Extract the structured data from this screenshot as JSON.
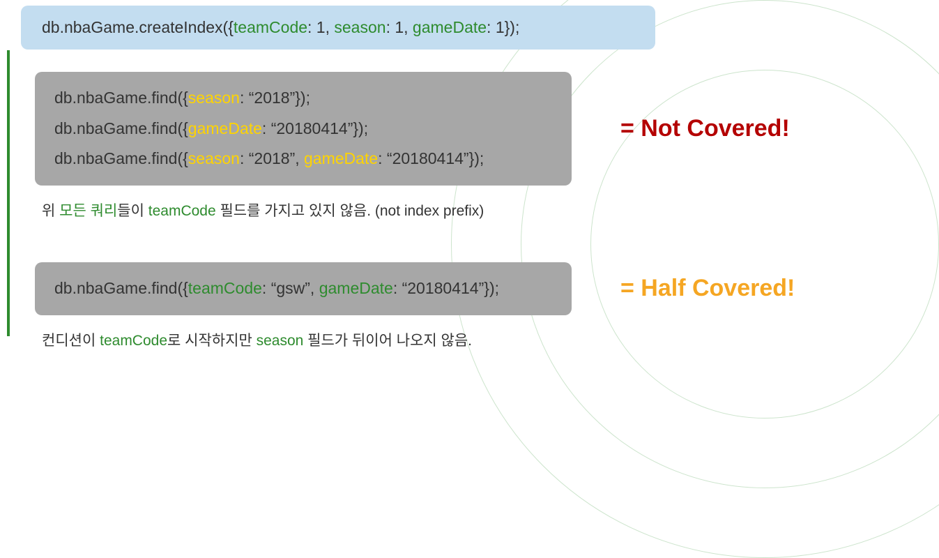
{
  "blue": {
    "prefix": "db.nbaGame.createIndex({",
    "f1": "teamCode",
    "c1": ": 1, ",
    "f2": "season",
    "c2": ": 1, ",
    "f3": "gameDate",
    "suffix": ": 1});"
  },
  "gray1": {
    "l1": {
      "prefix": "db.nbaGame.find({",
      "f1": "season",
      "rest": ": “2018”});"
    },
    "l2": {
      "prefix": "db.nbaGame.find({",
      "f1": "gameDate",
      "rest": ": “20180414”});"
    },
    "l3": {
      "prefix": "db.nbaGame.find({",
      "f1": "season",
      "mid": ": “2018”, ",
      "f2": "gameDate",
      "rest": ": “20180414”});"
    }
  },
  "label1": "= Not Covered!",
  "caption1": {
    "p1": "위 ",
    "g1": "모든 쿼리",
    "p2": "들이 ",
    "g2": "teamCode",
    "p3": " 필드를 가지고 있지 않음. (not index prefix)"
  },
  "gray2": {
    "prefix": "db.nbaGame.find({",
    "f1": "teamCode",
    "mid": ": “gsw”, ",
    "f2": "gameDate",
    "rest": ": “20180414”});"
  },
  "label2": "= Half Covered!",
  "caption2": {
    "p1": "컨디션이 ",
    "g1": "teamCode",
    "p2": "로 시작하지만 ",
    "g2": "season",
    "p3": " 필드가 뒤이어 나오지 않음."
  }
}
